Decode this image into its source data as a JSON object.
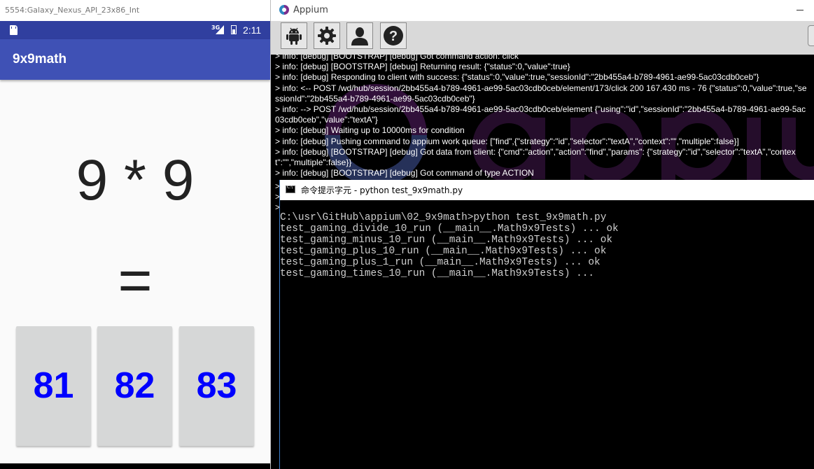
{
  "emulator": {
    "window_title": "5554:Galaxy_Nexus_API_23x86_Int",
    "status_bar": {
      "network": "3G",
      "time": "2:11"
    },
    "app_title": "9x9math",
    "question": "9 * 9",
    "equals": "=",
    "answers": [
      {
        "label": "81"
      },
      {
        "label": "82"
      },
      {
        "label": "83"
      }
    ],
    "answer_color": "#0000ff"
  },
  "appium": {
    "window_title": "Appium",
    "toolbar_icons": [
      "android-icon",
      "gear-icon",
      "user-icon",
      "help-icon"
    ],
    "log_lines": [
      "> info: [debug] [BOOTSTRAP] [debug] Got command action: click",
      "> info: [debug] [BOOTSTRAP] [debug] Returning result: {\"status\":0,\"value\":true}",
      "> info: [debug] Responding to client with success: {\"status\":0,\"value\":true,\"sessionId\":\"2bb455a4-b789-4961-ae99-5ac03cdb0ceb\"}",
      "> info: <-- POST /wd/hub/session/2bb455a4-b789-4961-ae99-5ac03cdb0ceb/element/173/click 200 167.430 ms - 76 {\"status\":0,\"value\":true,\"sessionId\":\"2bb455a4-b789-4961-ae99-5ac03cdb0ceb\"}",
      "> info: --> POST /wd/hub/session/2bb455a4-b789-4961-ae99-5ac03cdb0ceb/element {\"using\":\"id\",\"sessionId\":\"2bb455a4-b789-4961-ae99-5ac03cdb0ceb\",\"value\":\"textA\"}",
      "> info: [debug] Waiting up to 10000ms for condition",
      "> info: [debug] Pushing command to appium work queue: [\"find\",{\"strategy\":\"id\",\"selector\":\"textA\",\"context\":\"\",\"multiple\":false}]",
      "> info: [debug] [BOOTSTRAP] [debug] Got data from client: {\"cmd\":\"action\",\"action\":\"find\",\"params\": {\"strategy\":\"id\",\"selector\":\"textA\",\"context\":\"\",\"multiple\":false}}",
      "> info: [debug] [BOOTSTRAP] [debug] Got command of type ACTION"
    ],
    "log_markers": [
      ">",
      ">",
      ">"
    ]
  },
  "cmd": {
    "window_title": "命令提示字元 - python  test_9x9math.py",
    "output_lines": [
      "C:\\usr\\GitHub\\appium\\02_9x9math>python test_9x9math.py",
      "test_gaming_divide_10_run (__main__.Math9x9Tests) ... ok",
      "test_gaming_minus_10_run (__main__.Math9x9Tests) ... ok",
      "test_gaming_plus_10_run (__main__.Math9x9Tests) ... ok",
      "test_gaming_plus_1_run (__main__.Math9x9Tests) ... ok",
      "test_gaming_times_10_run (__main__.Math9x9Tests) ..."
    ]
  }
}
